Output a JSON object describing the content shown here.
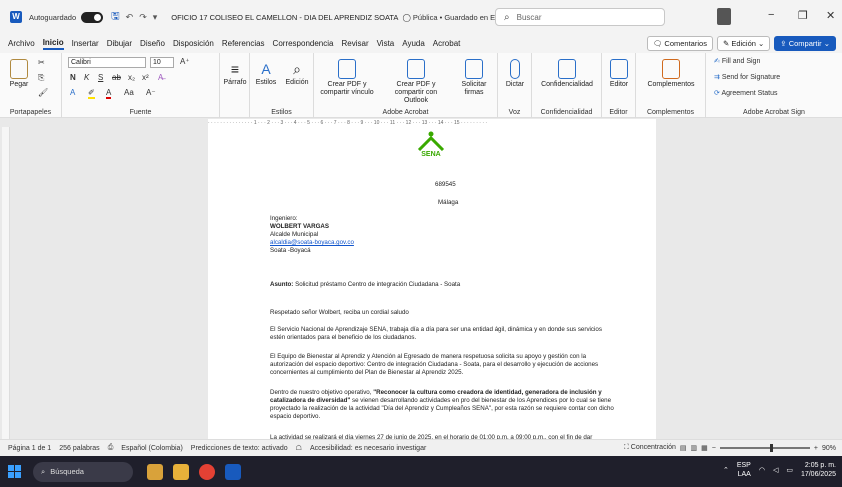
{
  "titlebar": {
    "autosave_label": "Autoguardado",
    "doc_title": "OFICIO 17 COLISEO EL CAMELLON - DIA DEL APRENDIZ SOATA",
    "cloud_status": "Pública • Guardado en Este PC",
    "search_placeholder": "Buscar"
  },
  "menu": {
    "items": [
      "Archivo",
      "Inicio",
      "Insertar",
      "Dibujar",
      "Diseño",
      "Disposición",
      "Referencias",
      "Correspondencia",
      "Revisar",
      "Vista",
      "Ayuda",
      "Acrobat"
    ],
    "comments": "Comentarios",
    "editing": "Edición",
    "share": "Compartir"
  },
  "ribbon": {
    "paste": "Pegar",
    "clipboard": "Portapapeles",
    "font_name": "Calibri",
    "font_size": "10",
    "font_group": "Fuente",
    "paragraph": "Párrafo",
    "styles": "Estilos",
    "styles_group": "Estilos",
    "edit": "Edición",
    "create_pdf": "Crear PDF y compartir vínculo",
    "create_pdf_outlook": "Crear PDF y compartir con Outlook",
    "request_sign": "Solicitar firmas",
    "acrobat_group": "Adobe Acrobat",
    "dictate": "Dictar",
    "voice_group": "Voz",
    "confidentiality": "Confidencialidad",
    "confidentiality_group": "Confidencialidad",
    "editor": "Editor",
    "editor_group": "Editor",
    "addins": "Complementos",
    "addins_group": "Complementos",
    "fill_sign": "Fill and Sign",
    "send_sig": "Send for Signature",
    "agreement": "Agreement Status",
    "adobe_sign_group": "Adobe Acrobat Sign"
  },
  "document": {
    "logo_text": "SENA",
    "number": "689545",
    "city": "Málaga",
    "salutation_title": "Ingeniero:",
    "recipient_name": "WOLBERT VARGAS",
    "recipient_role": "Alcalde Municipal",
    "recipient_email": "alcaldia@soata-boyaca.gov.co",
    "recipient_city": "Soata -Boyacá",
    "subject_label": "Asunto:",
    "subject": "Solicitud préstamo Centro de integración Ciudadana - Soata",
    "greeting": "Respetado señor Wolbert, reciba un cordial saludo",
    "p1": "El Servicio Nacional de Aprendizaje SENA, trabaja día a día para ser una entidad ágil, dinámica y en donde sus servicios estén orientados para el beneficio de los ciudadanos.",
    "p2": "El Equipo de Bienestar al Aprendiz y Atención al Egresado de manera respetuosa solicita su apoyo y gestión con la autorización del espacio deportivo: Centro de integración Ciudadana - Soata, para el desarrollo y ejecución de acciones concernientes al cumplimiento del Plan de Bienestar al Aprendiz 2025.",
    "p3_start": "Dentro de nuestro objetivo operativo, ",
    "p3_bold": "\"Reconocer la cultura como creadora de identidad, generadora de inclusión y catalizadora de diversidad\"",
    "p3_end": " se vienen desarrollando actividades en pro del bienestar de los Aprendices por lo cual se tiene proyectado la realización de la actividad \"Día del Aprendiz y Cumpleaños SENA\", por esta razón se requiere contar con dicho espacio deportivo.",
    "p4_partial": "La actividad se realizará el día viernes 27 de junio de 2025, en el horario de 01:00 p.m. a 09:00 p.m., con el fin de dar"
  },
  "status": {
    "page": "Página 1 de 1",
    "words": "256 palabras",
    "language": "Español (Colombia)",
    "predictions": "Predicciones de texto: activado",
    "accessibility": "Accesibilidad: es necesario investigar",
    "focus": "Concentración",
    "zoom": "90%"
  },
  "taskbar": {
    "search": "Búsqueda",
    "lang": "ESP",
    "lang2": "LAA",
    "time": "2:05 p. m.",
    "date": "17/06/2025"
  }
}
